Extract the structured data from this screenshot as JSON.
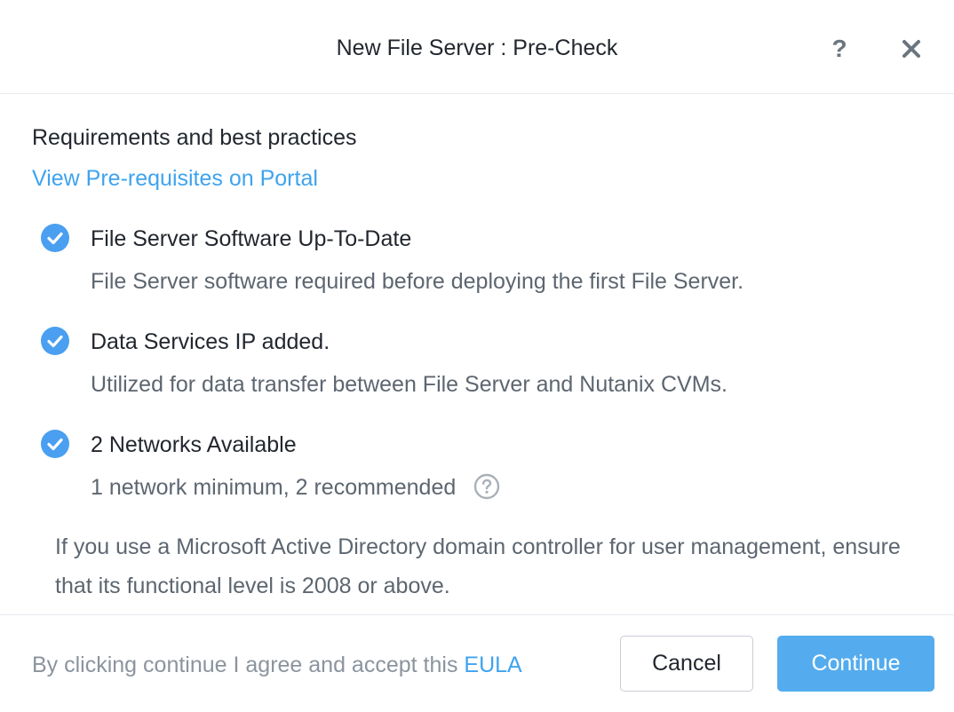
{
  "dialog": {
    "title": "New File Server : Pre-Check",
    "help_label": "?",
    "close_icon": "close-icon"
  },
  "body": {
    "section_heading": "Requirements and best practices",
    "portal_link": "View Pre-requisites on Portal",
    "checks": [
      {
        "title": "File Server Software Up-To-Date",
        "description": "File Server software required before deploying the first File Server.",
        "status": "passed",
        "icon": "check-circle-icon"
      },
      {
        "title": "Data Services IP added.",
        "description": "Utilized for data transfer between File Server and Nutanix CVMs.",
        "status": "passed",
        "icon": "check-circle-icon"
      },
      {
        "title": "2 Networks Available",
        "description": "1 network minimum, 2 recommended",
        "status": "passed",
        "icon": "check-circle-icon",
        "info_icon": "question-circle-icon"
      }
    ],
    "ad_note": "If you use a Microsoft Active Directory domain controller for user management, ensure that its functional level is 2008 or above."
  },
  "footer": {
    "eula_prefix": "By clicking continue I agree and accept this ",
    "eula_link": "EULA",
    "cancel_label": "Cancel",
    "continue_label": "Continue"
  },
  "colors": {
    "accent": "#3ea3ef",
    "primary_button": "#54acee",
    "check_icon": "#4a9ff0",
    "muted_text": "#5d6670"
  }
}
